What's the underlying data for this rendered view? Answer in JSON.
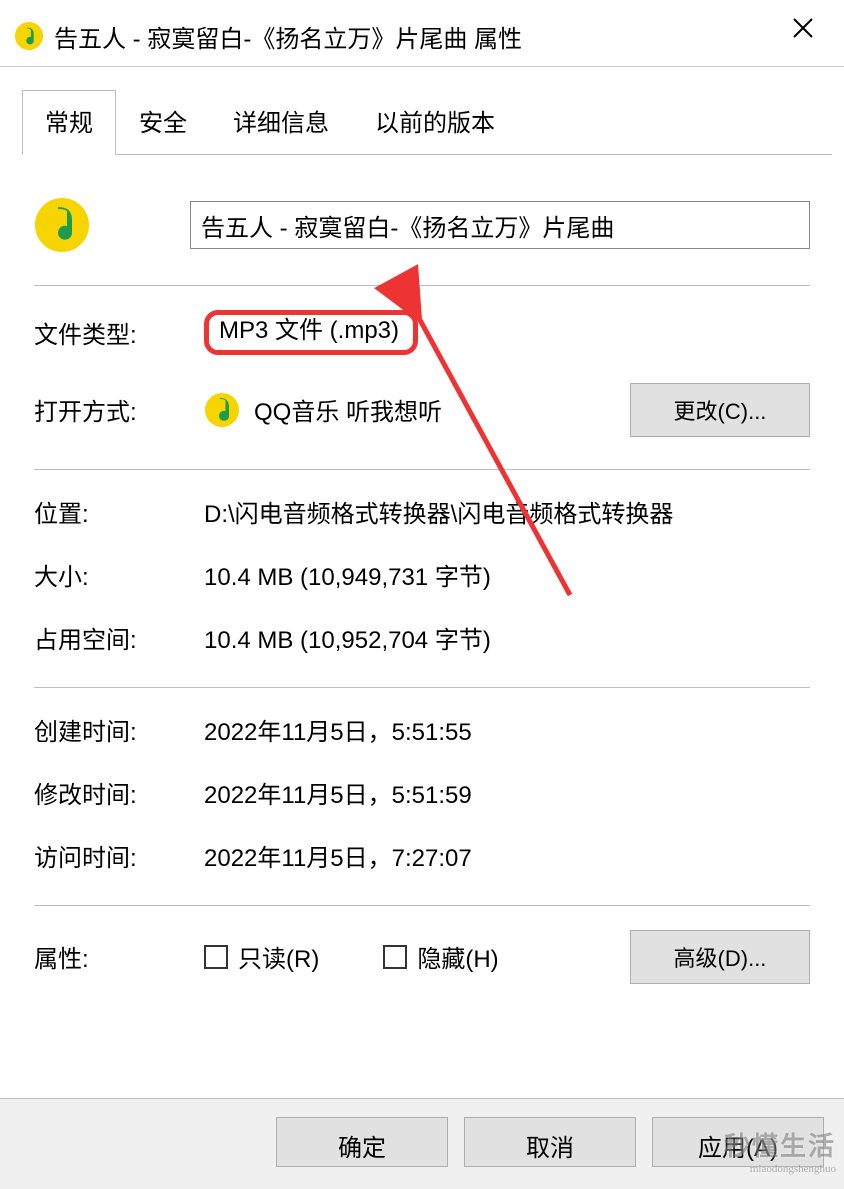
{
  "window": {
    "title": "告五人 - 寂寞留白-《扬名立万》片尾曲 属性"
  },
  "tabs": {
    "general": "常规",
    "security": "安全",
    "details": "详细信息",
    "previous": "以前的版本"
  },
  "file": {
    "name": "告五人 - 寂寞留白-《扬名立万》片尾曲"
  },
  "labels": {
    "file_type": "文件类型:",
    "opens_with": "打开方式:",
    "location": "位置:",
    "size": "大小:",
    "size_on_disk": "占用空间:",
    "created": "创建时间:",
    "modified": "修改时间:",
    "accessed": "访问时间:",
    "attributes": "属性:"
  },
  "values": {
    "file_type": "MP3 文件 (.mp3)",
    "opens_with_app": "QQ音乐 听我想听",
    "location": "D:\\闪电音频格式转换器\\闪电音频格式转换器",
    "size": "10.4 MB (10,949,731 字节)",
    "size_on_disk": "10.4 MB (10,952,704 字节)",
    "created": "2022年11月5日，5:51:55",
    "modified": "2022年11月5日，5:51:59",
    "accessed": "2022年11月5日，7:27:07"
  },
  "buttons": {
    "change": "更改(C)...",
    "advanced": "高级(D)...",
    "ok": "确定",
    "cancel": "取消",
    "apply": "应用(A)"
  },
  "checkboxes": {
    "readonly": "只读(R)",
    "hidden": "隐藏(H)"
  },
  "watermark": {
    "main": "秒懂生活",
    "sub": "miaodongshenghuo"
  }
}
